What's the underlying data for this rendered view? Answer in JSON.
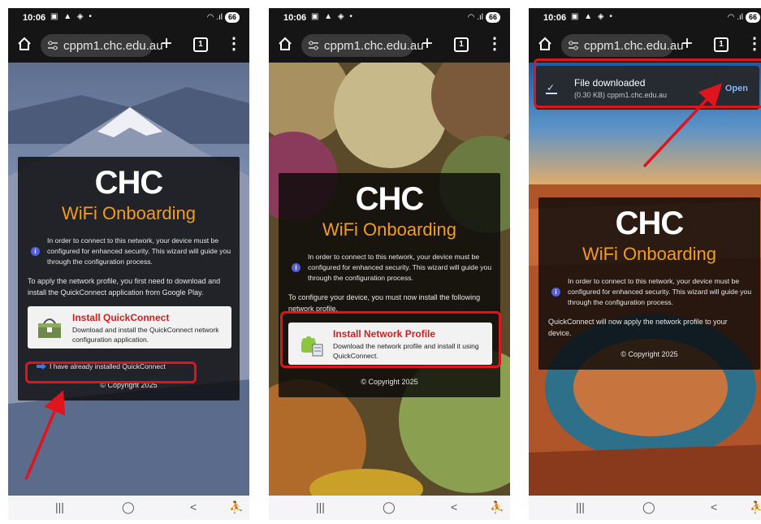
{
  "status": {
    "time": "10:06",
    "battery": "66"
  },
  "browser": {
    "url": "cppm1.chc.edu.au"
  },
  "card": {
    "logo": "CHC",
    "heading": "WiFi Onboarding",
    "intro": "In order to connect to this network, your device must be configured for enhanced security. This wizard will guide you through the configuration process.",
    "copyright": "© Copyright 2025"
  },
  "screen1": {
    "para": "To apply the network profile, you first need to download and install the QuickConnect application from Google Play.",
    "install_title": "Install QuickConnect",
    "install_desc": "Download and install the QuickConnect network configuration application.",
    "already": "I have already installed QuickConnect"
  },
  "screen2": {
    "para": "To configure your device, you must now install the following network profile.",
    "install_title": "Install Network Profile",
    "install_desc": "Download the network profile and install it using QuickConnect."
  },
  "screen3": {
    "toast_title": "File downloaded",
    "toast_detail": "(0.30 KB) cppm1.chc.edu.au",
    "toast_action": "Open",
    "para": "QuickConnect will now apply the network profile to your device."
  },
  "navbar": {
    "recents": "|||",
    "home": "◯",
    "back": "<",
    "accessibility": "⛹"
  }
}
